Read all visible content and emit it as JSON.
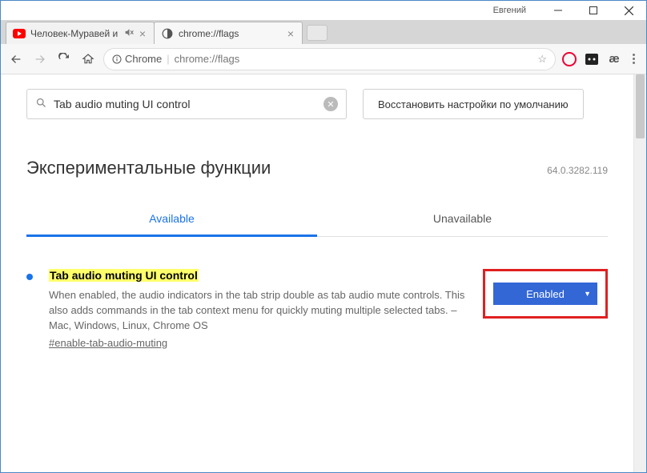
{
  "titlebar": {
    "user": "Евгений"
  },
  "tabs": [
    {
      "title": "Человек-Муравей и",
      "muted": true
    },
    {
      "title": "chrome://flags"
    }
  ],
  "omnibox": {
    "secureLabel": "Chrome",
    "url": "chrome://flags"
  },
  "search": {
    "query": "Tab audio muting UI control"
  },
  "resetButton": "Восстановить настройки по умолчанию",
  "heading": "Экспериментальные функции",
  "version": "64.0.3282.119",
  "flagTabs": {
    "available": "Available",
    "unavailable": "Unavailable"
  },
  "flag": {
    "title": "Tab audio muting UI control",
    "desc": "When enabled, the audio indicators in the tab strip double as tab audio mute controls. This also adds commands in the tab context menu for quickly muting multiple selected tabs. – Mac, Windows, Linux, Chrome OS",
    "hash": "#enable-tab-audio-muting",
    "state": "Enabled"
  }
}
